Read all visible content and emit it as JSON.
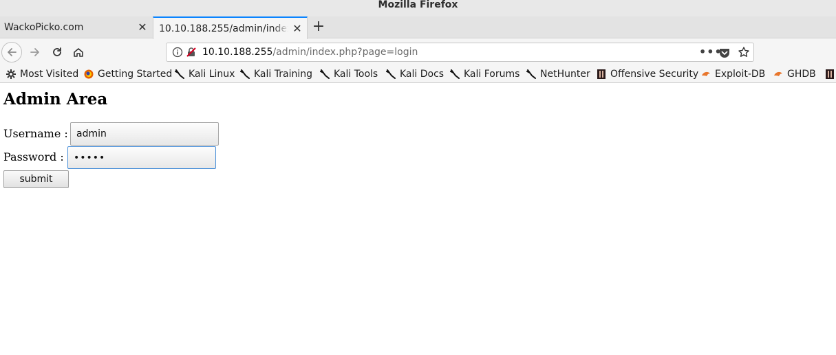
{
  "window": {
    "title": "Mozilla Firefox"
  },
  "tabs": [
    {
      "label": "WackoPicko.com",
      "active": false
    },
    {
      "label": "10.10.188.255/admin/index.php?page=login",
      "active": true
    }
  ],
  "urlbar": {
    "host": "10.10.188.255",
    "path": "/admin/index.php?page=login",
    "more_label": "•••"
  },
  "bookmarks": [
    {
      "label": "Most Visited",
      "icon": "gear-icon"
    },
    {
      "label": "Getting Started",
      "icon": "firefox-icon"
    },
    {
      "label": "Kali Linux",
      "icon": "kali-dragon-icon"
    },
    {
      "label": "Kali Training",
      "icon": "kali-dragon-icon"
    },
    {
      "label": "Kali Tools",
      "icon": "kali-dragon-icon"
    },
    {
      "label": "Kali Docs",
      "icon": "kali-dragon-icon"
    },
    {
      "label": "Kali Forums",
      "icon": "kali-dragon-icon"
    },
    {
      "label": "NetHunter",
      "icon": "kali-dragon-icon"
    },
    {
      "label": "Offensive Security",
      "icon": "offsec-icon"
    },
    {
      "label": "Exploit-DB",
      "icon": "exploitdb-icon"
    },
    {
      "label": "GHDB",
      "icon": "exploitdb-icon"
    }
  ],
  "page": {
    "heading": "Admin Area",
    "username_label": "Username :",
    "username_value": "admin",
    "password_label": "Password :",
    "password_mask": "•••••",
    "submit_label": "submit"
  },
  "colors": {
    "accent": "#0a84ff",
    "focus_border": "#4a90d9",
    "exploitdb_orange": "#e8762c"
  }
}
